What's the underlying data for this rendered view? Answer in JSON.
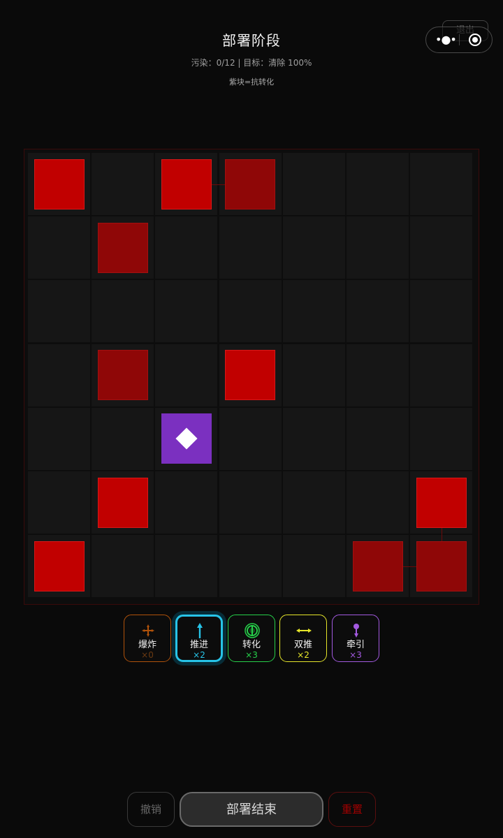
{
  "header": {
    "title": "部署阶段",
    "status": "污染：0/12 | 目标：清除 100%",
    "hint": "紫块=抗转化"
  },
  "topbar": {
    "exit_label": "退出",
    "menu_icon": "more-dots-icon",
    "close_icon": "target-circle-icon"
  },
  "board": {
    "rows": 7,
    "cols": 7,
    "cells": [
      [
        "red",
        "",
        "red",
        "dark",
        "",
        "",
        ""
      ],
      [
        "",
        "dark",
        "",
        "",
        "",
        "",
        ""
      ],
      [
        "",
        "",
        "",
        "",
        "",
        "",
        ""
      ],
      [
        "",
        "dark",
        "",
        "red",
        "",
        "",
        ""
      ],
      [
        "",
        "",
        "purple",
        "",
        "",
        "",
        ""
      ],
      [
        "",
        "red",
        "",
        "",
        "",
        "",
        "red"
      ],
      [
        "red",
        "",
        "",
        "",
        "",
        "dark",
        "dark"
      ]
    ],
    "legend": {
      "red": "#c10000",
      "dark": "#8f0707",
      "purple": "#7b30c0"
    }
  },
  "tools": [
    {
      "name": "爆炸",
      "count": "×0",
      "color": "#b0520a",
      "count_color": "#6b3a12",
      "icon": "explosion-cross-icon",
      "selected": false
    },
    {
      "name": "推进",
      "count": "×2",
      "color": "#27c4e8",
      "count_color": "#27c4e8",
      "icon": "push-arrow-up-icon",
      "selected": true
    },
    {
      "name": "转化",
      "count": "×3",
      "color": "#26d04a",
      "count_color": "#26d04a",
      "icon": "convert-ring-icon",
      "selected": false
    },
    {
      "name": "双推",
      "count": "×2",
      "color": "#e6e62a",
      "count_color": "#e6e62a",
      "icon": "double-push-arrow-icon",
      "selected": false
    },
    {
      "name": "牵引",
      "count": "×3",
      "color": "#a35ae0",
      "count_color": "#a35ae0",
      "icon": "pull-pin-icon",
      "selected": false
    }
  ],
  "actions": {
    "undo": "撤销",
    "end": "部署结束",
    "reset": "重置"
  }
}
